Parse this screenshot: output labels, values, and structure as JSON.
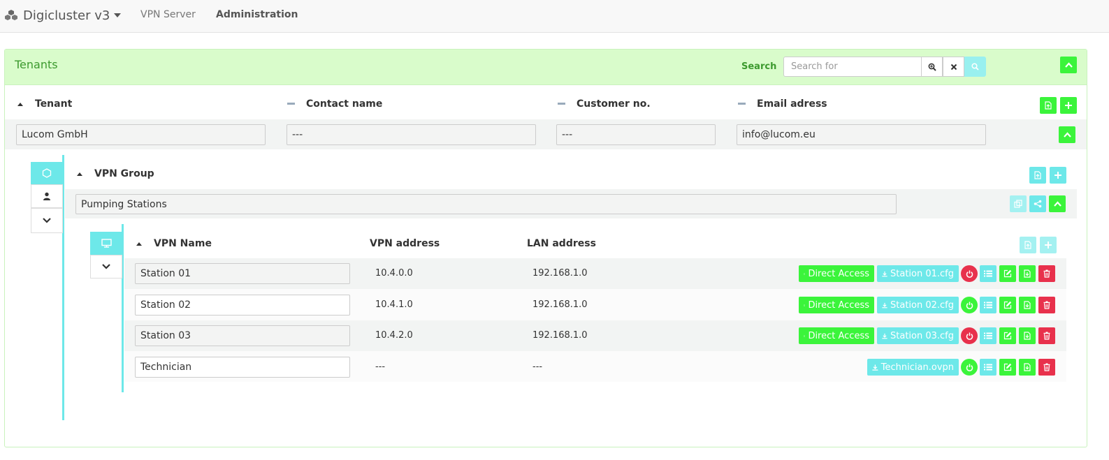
{
  "navbar": {
    "brand": "Digicluster v3",
    "links": [
      "VPN Server",
      "Administration"
    ]
  },
  "tenants_panel": {
    "title": "Tenants",
    "search_label": "Search",
    "search_placeholder": "Search for",
    "columns": [
      "Tenant",
      "Contact name",
      "Customer no.",
      "Email adress"
    ],
    "row": {
      "tenant": "Lucom GmbH",
      "contact": "---",
      "customer_no": "---",
      "email": "info@lucom.eu"
    }
  },
  "vpn_group": {
    "column": "VPN Group",
    "name": "Pumping Stations"
  },
  "vpn_table": {
    "columns": [
      "VPN Name",
      "VPN address",
      "LAN address"
    ],
    "direct_access_label": "Direct Access",
    "rows": [
      {
        "name": "Station 01",
        "vpn": "10.4.0.0",
        "lan": "192.168.1.0",
        "file": "Station 01.cfg",
        "online": false
      },
      {
        "name": "Station 02",
        "vpn": "10.4.1.0",
        "lan": "192.168.1.0",
        "file": "Station 02.cfg",
        "online": true
      },
      {
        "name": "Station 03",
        "vpn": "10.4.2.0",
        "lan": "192.168.1.0",
        "file": "Station 03.cfg",
        "online": false
      },
      {
        "name": "Technician",
        "vpn": "---",
        "lan": "---",
        "file": "Technician.ovpn",
        "online": true
      }
    ]
  },
  "colors": {
    "green": "#3bf43b",
    "cyan": "#6de8e9",
    "red": "#e8314c",
    "panel_header": "#d9fccb"
  }
}
